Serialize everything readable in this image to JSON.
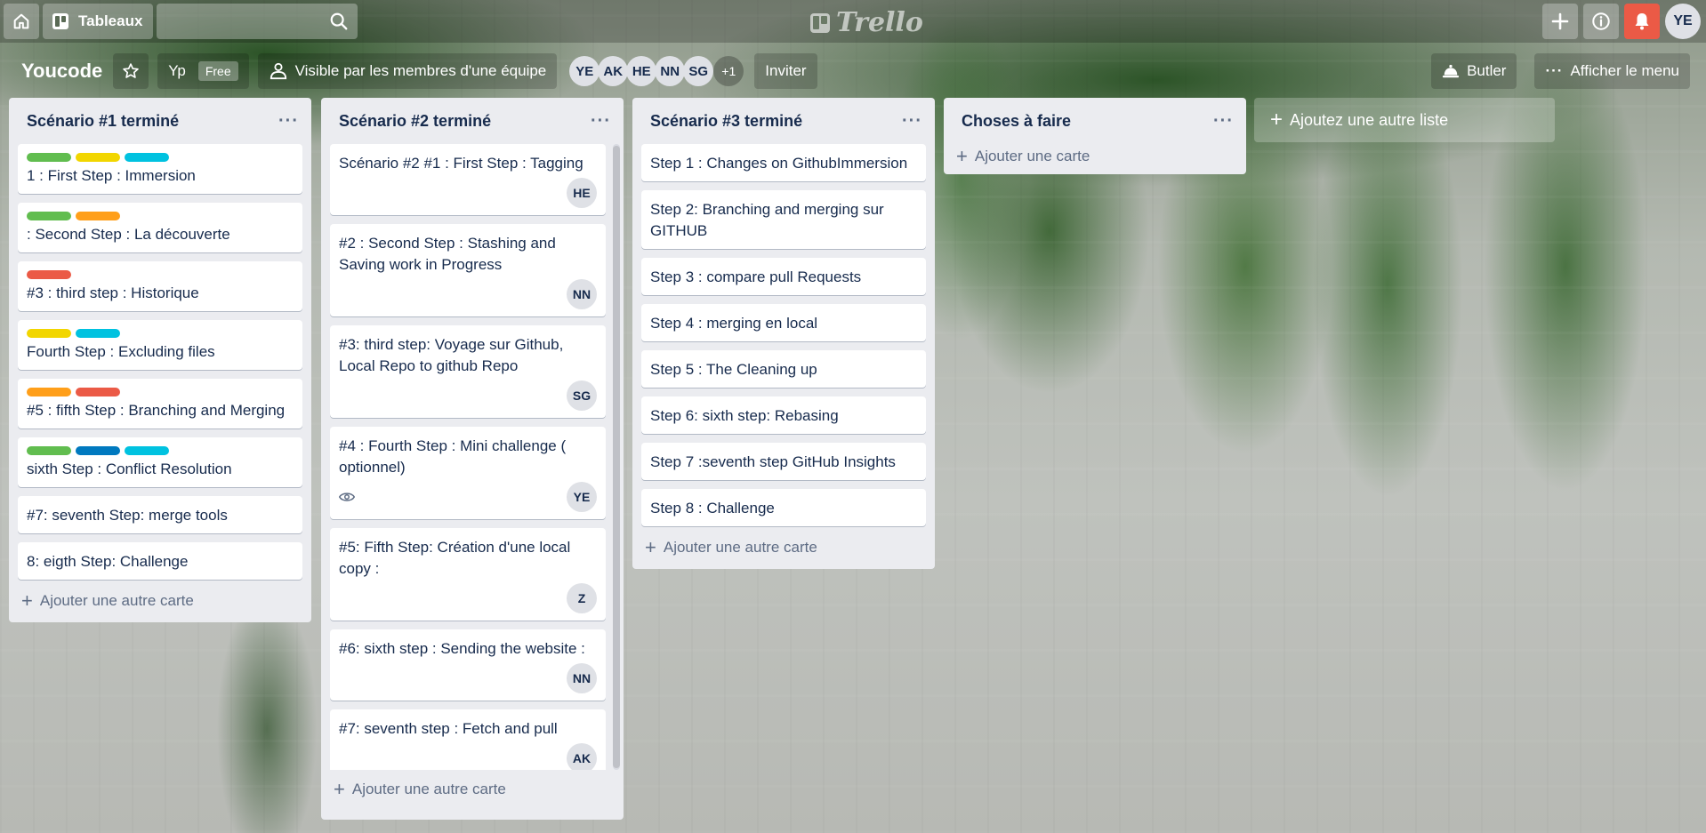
{
  "topbar": {
    "boards_label": "Tableaux",
    "search_value": "",
    "logo_text": "Trello",
    "user_initials": "YE"
  },
  "board": {
    "name": "Youcode",
    "team_short": "Yp",
    "team_badge": "Free",
    "visibility": "Visible par les membres d'une équipe",
    "members": [
      "YE",
      "AK",
      "HE",
      "NN",
      "SG"
    ],
    "members_more": "+1",
    "invite_label": "Inviter",
    "butler_label": "Butler",
    "menu_label": "Afficher le menu"
  },
  "colors": {
    "green": "#61bd4f",
    "yellow": "#f2d600",
    "sky": "#00c2e0",
    "orange": "#ff9f1a",
    "red": "#eb5a46",
    "blue": "#0079bf"
  },
  "lists": [
    {
      "title": "Scénario #1 terminé",
      "add_label": "Ajouter une autre carte",
      "cards": [
        {
          "text": "1 : First Step : Immersion",
          "labels": [
            "green",
            "yellow",
            "sky"
          ]
        },
        {
          "text": ": Second Step : La découverte",
          "labels": [
            "green",
            "orange"
          ]
        },
        {
          "text": "#3 : third step : Historique",
          "labels": [
            "red"
          ]
        },
        {
          "text": "Fourth Step : Excluding files",
          "labels": [
            "yellow",
            "sky"
          ]
        },
        {
          "text": "#5 : fifth Step : Branching and Merging",
          "labels": [
            "orange",
            "red"
          ]
        },
        {
          "text": "sixth Step : Conflict Resolution",
          "labels": [
            "green",
            "blue",
            "sky"
          ]
        },
        {
          "text": "#7: seventh Step: merge tools",
          "labels": []
        },
        {
          "text": "8: eigth Step: Challenge",
          "labels": []
        }
      ]
    },
    {
      "title": "Scénario #2 terminé",
      "add_label": "Ajouter une autre carte",
      "cards": [
        {
          "text": "Scénario #2 #1 : First Step : Tagging",
          "member": "HE"
        },
        {
          "text": "#2 : Second Step : Stashing and Saving work in Progress",
          "member": "NN"
        },
        {
          "text": "#3: third step: Voyage sur Github, Local Repo to github Repo",
          "member": "SG"
        },
        {
          "text": "#4 : Fourth Step : Mini challenge ( optionnel)",
          "member": "YE",
          "watch": true
        },
        {
          "text": "#5: Fifth Step: Création d'une local copy :",
          "member": "Z"
        },
        {
          "text": "#6: sixth step : Sending the website :",
          "member": "NN"
        },
        {
          "text": "#7: seventh step : Fetch and pull",
          "member": "AK"
        }
      ]
    },
    {
      "title": "Scénario #3 terminé",
      "add_label": "Ajouter une autre carte",
      "cards": [
        {
          "text": "Step 1 : Changes on GithubImmersion"
        },
        {
          "text": "Step 2: Branching and merging sur GITHUB"
        },
        {
          "text": "Step 3 : compare pull Requests"
        },
        {
          "text": "Step 4 : merging en local"
        },
        {
          "text": "Step 5 : The Cleaning up"
        },
        {
          "text": "Step 6: sixth step: Rebasing"
        },
        {
          "text": "Step 7 :seventh step GitHub Insights"
        },
        {
          "text": "Step 8 : Challenge"
        }
      ]
    },
    {
      "title": "Choses à faire",
      "add_label": "Ajouter une carte",
      "cards": []
    }
  ],
  "add_list_label": "Ajoutez une autre liste"
}
